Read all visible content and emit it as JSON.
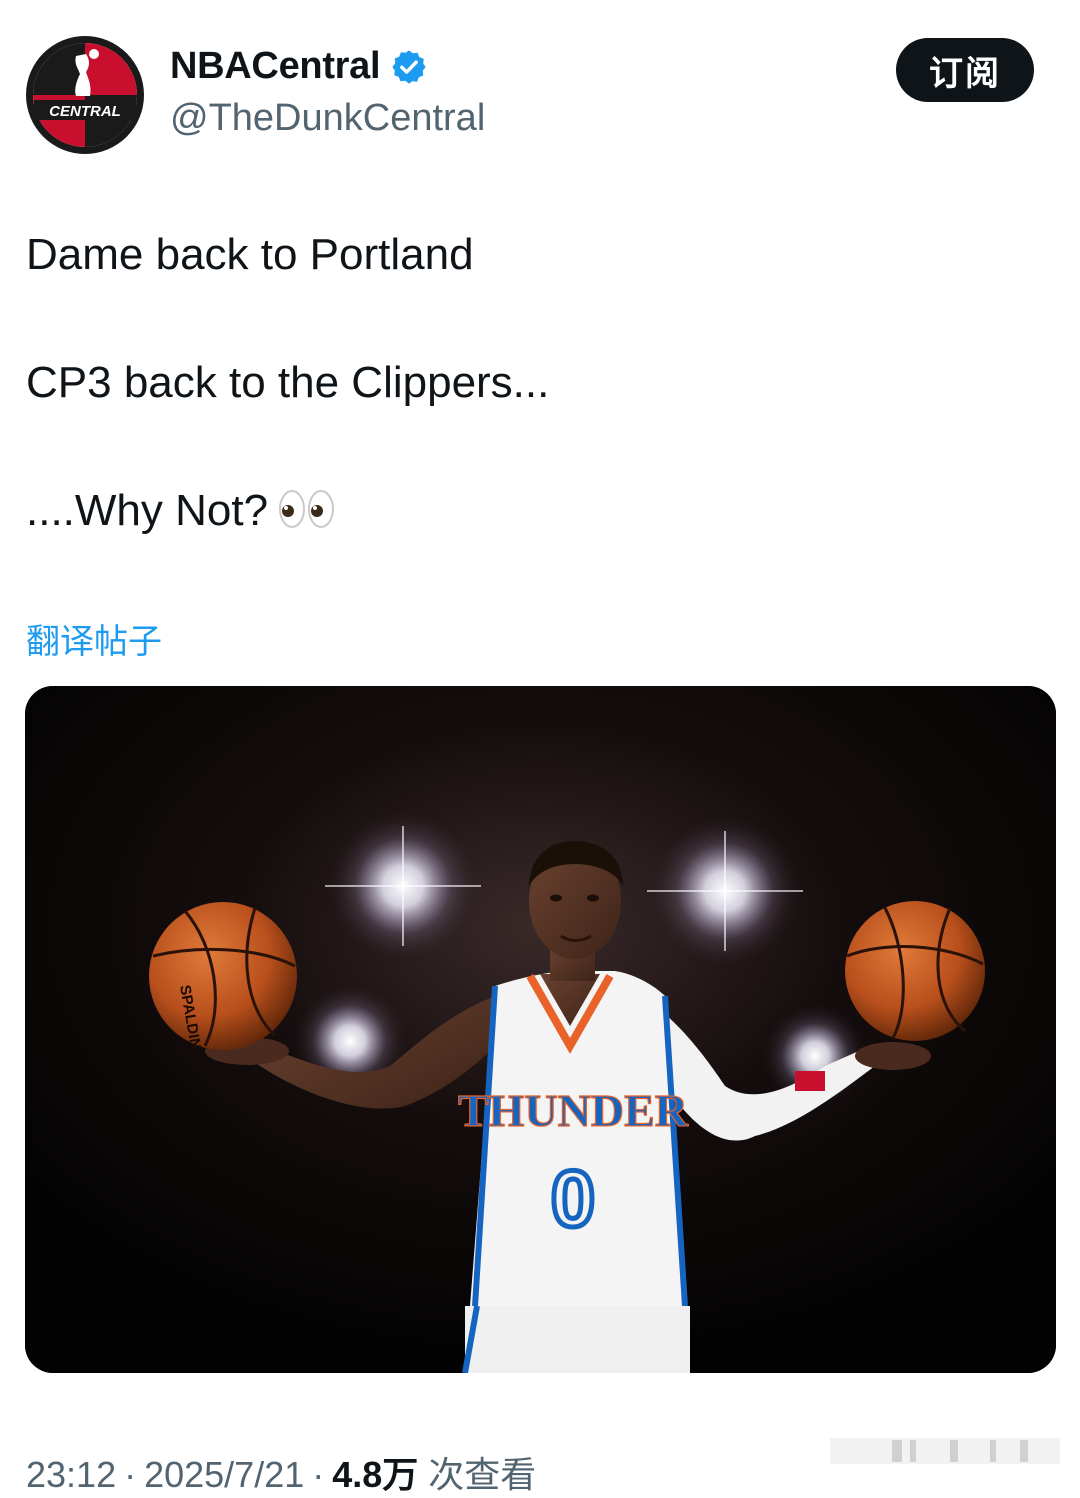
{
  "account": {
    "display_name": "NBACentral",
    "handle": "@TheDunkCentral",
    "verified": true,
    "avatar_icon": "nba-central-logo-icon",
    "avatar_text": "CENTRAL",
    "verified_color": "#1d9bf0"
  },
  "subscribe_button": {
    "label": "订阅"
  },
  "tweet": {
    "lines": [
      "Dame back to Portland",
      "CP3 back to the Clippers...",
      "....Why Not?"
    ],
    "emoji": "eyes-emoji",
    "translate_label": "翻译帖子"
  },
  "media": {
    "jersey_team": "THUNDER",
    "jersey_number": "0",
    "ball_brand": "SPALDING"
  },
  "meta": {
    "time": "23:12",
    "date": "2025/7/21",
    "views_count": "4.8万",
    "views_label": "次查看",
    "separator": "·"
  },
  "colors": {
    "text": "#0f1419",
    "secondary": "#536471",
    "link": "#1d9bf0",
    "button_bg": "#0f1419"
  }
}
